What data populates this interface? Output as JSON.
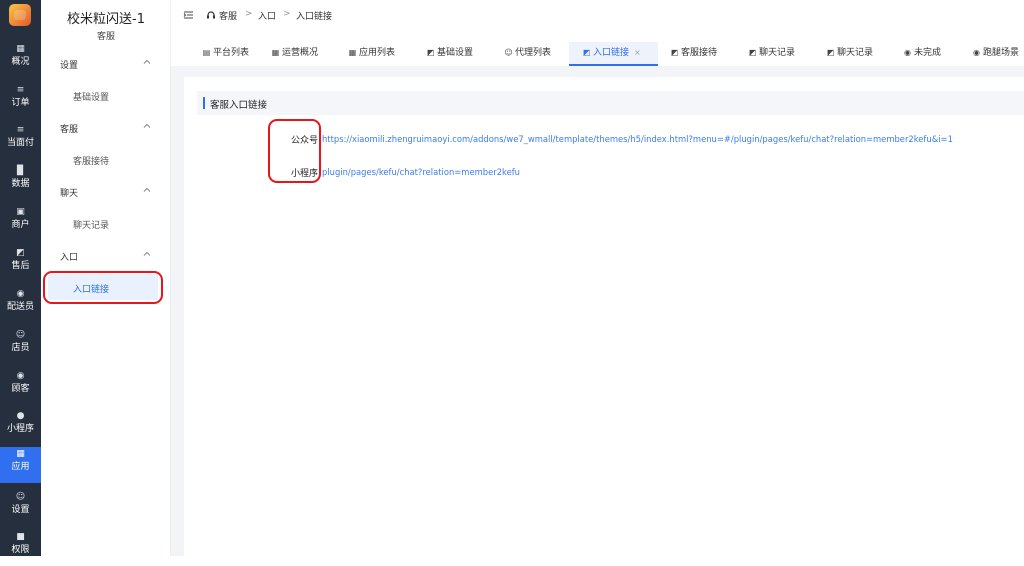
{
  "sidebar": {
    "items": [
      {
        "label": "概况",
        "icon": "dashboard-icon"
      },
      {
        "label": "订单",
        "icon": "list-icon"
      },
      {
        "label": "当面付",
        "icon": "list-icon"
      },
      {
        "label": "数据",
        "icon": "bar-chart-icon"
      },
      {
        "label": "商户",
        "icon": "store-icon"
      },
      {
        "label": "售后",
        "icon": "headset-icon"
      },
      {
        "label": "配送员",
        "icon": "delivery-icon"
      },
      {
        "label": "店员",
        "icon": "users-icon"
      },
      {
        "label": "顾客",
        "icon": "customer-icon"
      },
      {
        "label": "小程序",
        "icon": "wechat-icon"
      },
      {
        "label": "应用",
        "icon": "apps-icon"
      },
      {
        "label": "设置",
        "icon": "user-settings-icon"
      },
      {
        "label": "权限",
        "icon": "lock-icon"
      }
    ],
    "active_index": 10
  },
  "submenu": {
    "title": "校米粒闪送-1",
    "subtitle": "客服",
    "groups": [
      {
        "label": "设置",
        "items": [
          "基础设置"
        ]
      },
      {
        "label": "客服",
        "items": [
          "客服接待"
        ]
      },
      {
        "label": "聊天",
        "items": [
          "聊天记录"
        ]
      },
      {
        "label": "入口",
        "items": [
          "入口链接"
        ]
      }
    ]
  },
  "breadcrumb": {
    "items": [
      "客服",
      "入口",
      "入口链接"
    ],
    "separator": ">"
  },
  "tabs": [
    {
      "label": "平台列表",
      "icon": "layout-icon"
    },
    {
      "label": "运营概况",
      "icon": "dashboard-icon"
    },
    {
      "label": "应用列表",
      "icon": "apps-icon"
    },
    {
      "label": "基础设置",
      "icon": "headset-icon"
    },
    {
      "label": "代理列表",
      "icon": "users-icon"
    },
    {
      "label": "入口链接",
      "icon": "headset-icon",
      "active": true,
      "closable": true
    },
    {
      "label": "客服接待",
      "icon": "headset-icon"
    },
    {
      "label": "聊天记录",
      "icon": "headset-icon"
    },
    {
      "label": "聊天记录",
      "icon": "headset-icon"
    },
    {
      "label": "未完成",
      "icon": "delivery-icon"
    },
    {
      "label": "跑腿场景",
      "icon": "delivery-icon"
    }
  ],
  "main": {
    "section_title": "客服入口链接",
    "fields": [
      {
        "label": "公众号",
        "value": "https://xiaomili.zhengruimaoyi.com/addons/we7_wmall/template/themes/h5/index.html?menu=#/plugin/pages/kefu/chat?relation=member2kefu&i=1"
      },
      {
        "label": "小程序",
        "value": "plugin/pages/kefu/chat?relation=member2kefu"
      }
    ]
  },
  "colors": {
    "accent": "#2f6ff0",
    "rail": "#262f3e",
    "highlight": "#e8151b"
  }
}
